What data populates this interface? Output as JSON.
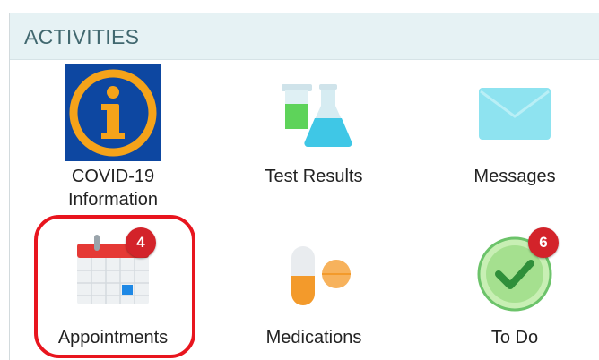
{
  "section": {
    "title": "ACTIVITIES"
  },
  "tiles": {
    "covid": {
      "label_line1": "COVID-19",
      "label_line2": "Information",
      "icon": "info-icon"
    },
    "test_results": {
      "label": "Test Results",
      "icon": "lab-flasks-icon"
    },
    "messages": {
      "label": "Messages",
      "icon": "envelope-icon"
    },
    "appointments": {
      "label": "Appointments",
      "icon": "calendar-icon",
      "badge": "4"
    },
    "medications": {
      "label": "Medications",
      "icon": "pill-capsule-icon"
    },
    "todo": {
      "label": "To Do",
      "icon": "checkmark-circle-icon",
      "badge": "6"
    }
  },
  "colors": {
    "header_bg": "#e6f2f4",
    "header_text": "#41686f",
    "badge": "#d3232a",
    "highlight": "#e8151e"
  }
}
